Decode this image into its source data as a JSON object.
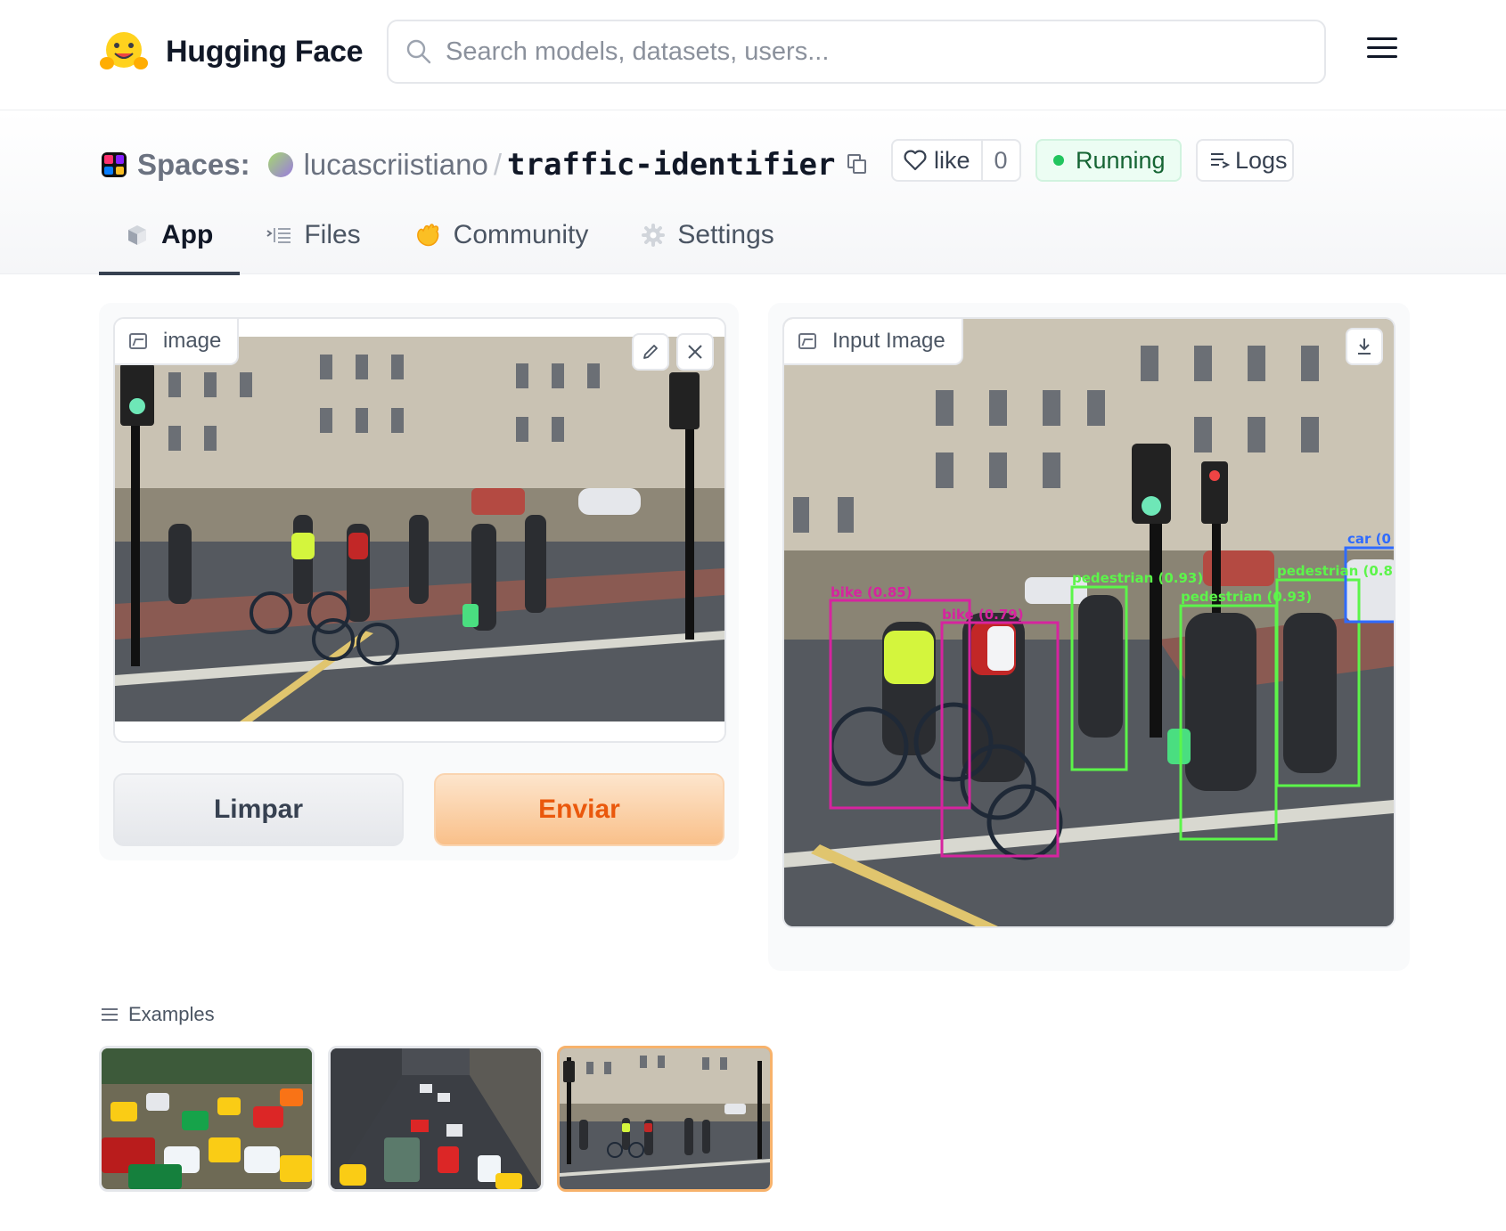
{
  "header": {
    "brand": "Hugging Face",
    "search_placeholder": "Search models, datasets, users...",
    "menu_icon": "hamburger-icon"
  },
  "space": {
    "section_label": "Spaces:",
    "owner": "lucascriistiano",
    "separator": "/",
    "repo": "traffic-identifier",
    "like_label": "like",
    "like_count": "0",
    "status": "Running",
    "logs_label": "Logs"
  },
  "tabs": [
    {
      "label": "App",
      "icon": "cube-icon",
      "active": true
    },
    {
      "label": "Files",
      "icon": "files-icon",
      "active": false
    },
    {
      "label": "Community",
      "icon": "community-icon",
      "active": false
    },
    {
      "label": "Settings",
      "icon": "gear-icon",
      "active": false
    }
  ],
  "input_panel": {
    "label": "image",
    "clear_button": "Limpar",
    "submit_button": "Enviar"
  },
  "output_panel": {
    "label": "Input Image",
    "detections": [
      {
        "label": "bike (0.85)",
        "color": "#d6249f"
      },
      {
        "label": "bike (0.79)",
        "color": "#d6249f"
      },
      {
        "label": "pedestrian (0.93)",
        "color": "#5cf54a"
      },
      {
        "label": "pedestrian (0.93)",
        "color": "#5cf54a"
      },
      {
        "label": "pedestrian (0.8",
        "color": "#5cf54a"
      },
      {
        "label": "car (0",
        "color": "#2f6bff"
      }
    ]
  },
  "examples": {
    "title": "Examples",
    "items": [
      {
        "name": "traffic-jam-rickshaws",
        "selected": false
      },
      {
        "name": "city-street-trucks",
        "selected": false
      },
      {
        "name": "crosswalk-pedestrians",
        "selected": true
      }
    ]
  },
  "colors": {
    "accent_orange": "#ea580c",
    "running_green": "#22c55e",
    "bike_box": "#d6249f",
    "pedestrian_box": "#5cf54a",
    "car_box": "#2f6bff"
  }
}
